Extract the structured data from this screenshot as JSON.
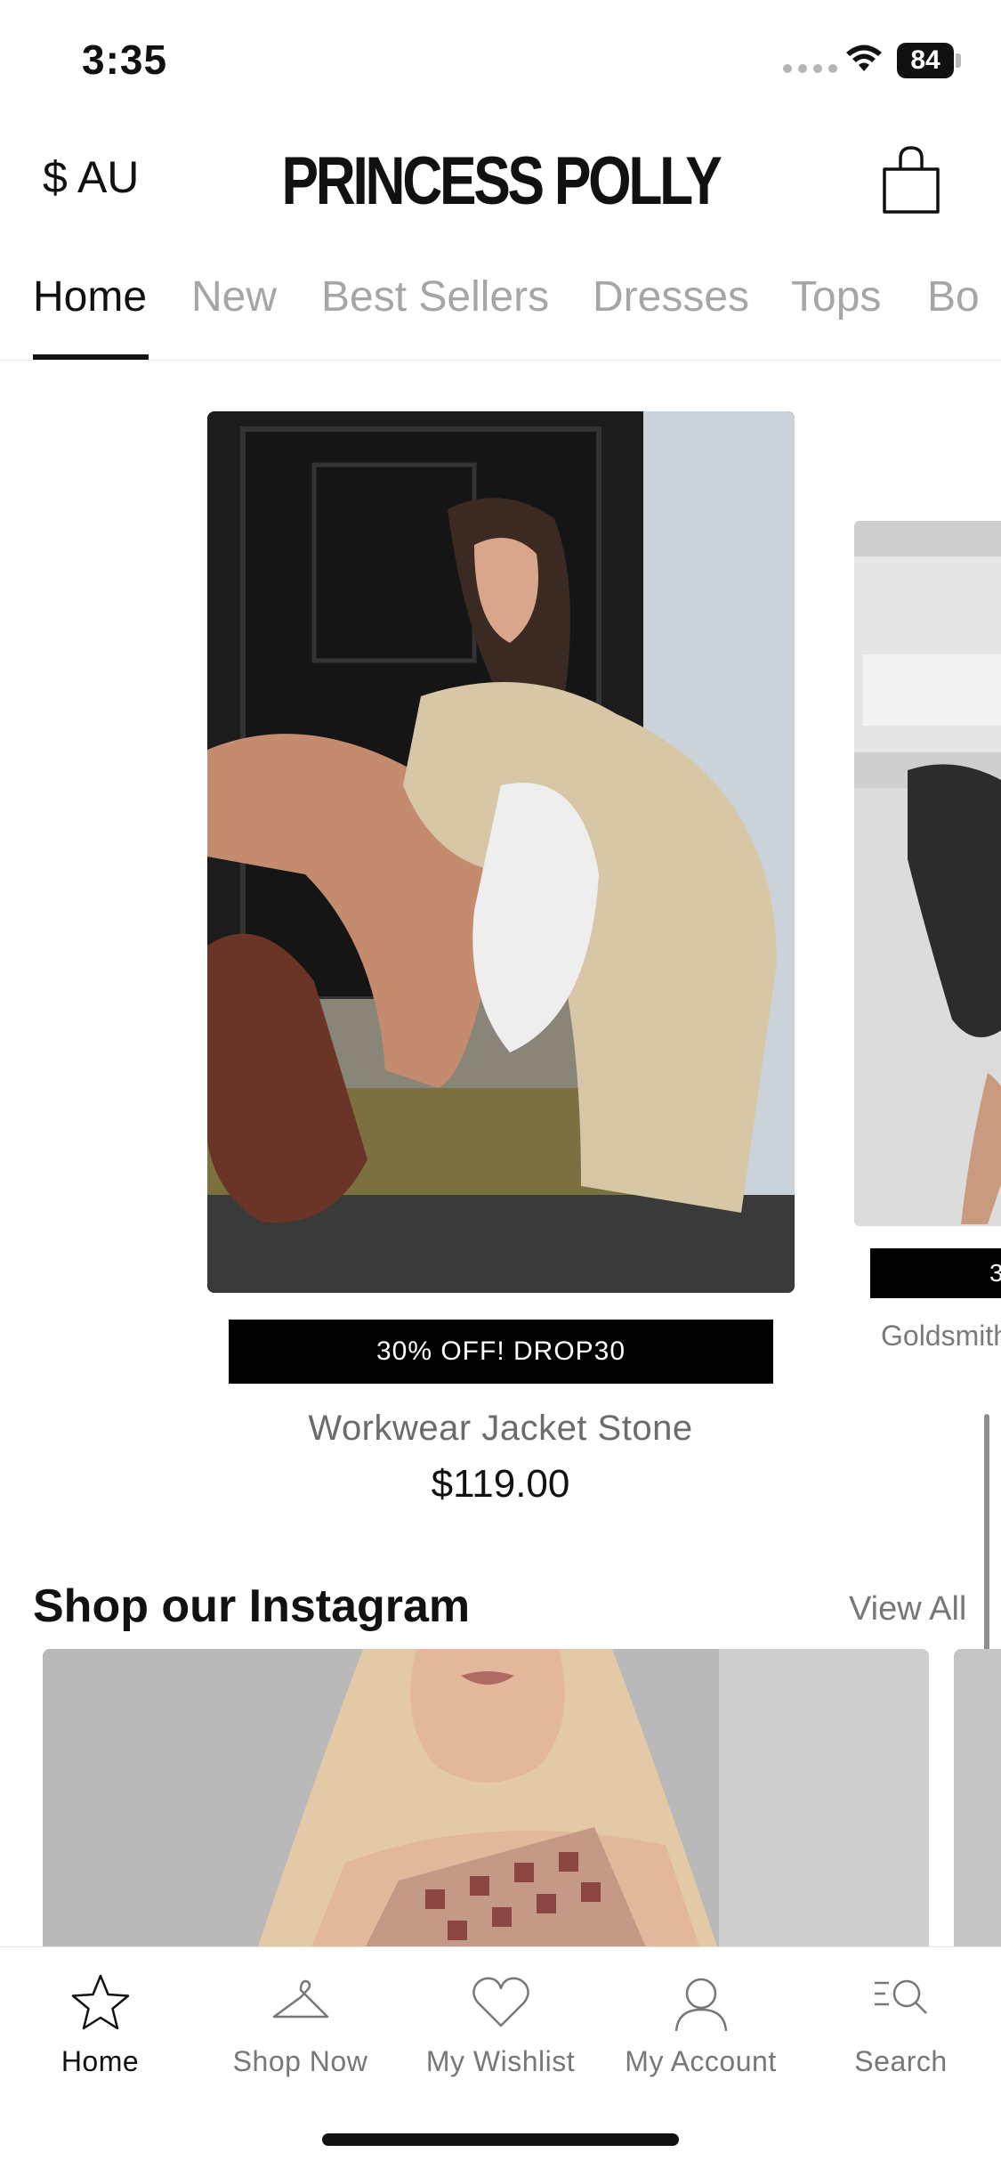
{
  "status_bar": {
    "time": "3:35",
    "battery": "84",
    "icons": [
      "cellular-icon",
      "wifi-icon",
      "battery-icon"
    ]
  },
  "header": {
    "currency": "$ AU",
    "brand": "PRINCESS POLLY",
    "cart_icon": "shopping-bag-icon"
  },
  "tabs": [
    {
      "label": "Home",
      "active": true
    },
    {
      "label": "New",
      "active": false
    },
    {
      "label": "Best Sellers",
      "active": false
    },
    {
      "label": "Dresses",
      "active": false
    },
    {
      "label": "Tops",
      "active": false
    },
    {
      "label": "Bo",
      "active": false
    }
  ],
  "products": [
    {
      "promo": "30% OFF! DROP30",
      "name": "Workwear Jacket Stone",
      "price": "$119.00"
    },
    {
      "promo": "3",
      "name": "Goldsmith"
    }
  ],
  "instagram": {
    "title": "Shop our Instagram",
    "view_all": "View All"
  },
  "bottom_nav": [
    {
      "label": "Home",
      "icon": "star-icon",
      "active": true
    },
    {
      "label": "Shop Now",
      "icon": "hanger-icon",
      "active": false
    },
    {
      "label": "My Wishlist",
      "icon": "heart-icon",
      "active": false
    },
    {
      "label": "My Account",
      "icon": "user-icon",
      "active": false
    },
    {
      "label": "Search",
      "icon": "search-icon",
      "active": false
    }
  ],
  "colors": {
    "text_primary": "#111111",
    "text_muted": "#a6a6a6",
    "banner_bg": "#000000",
    "background": "#ffffff"
  }
}
